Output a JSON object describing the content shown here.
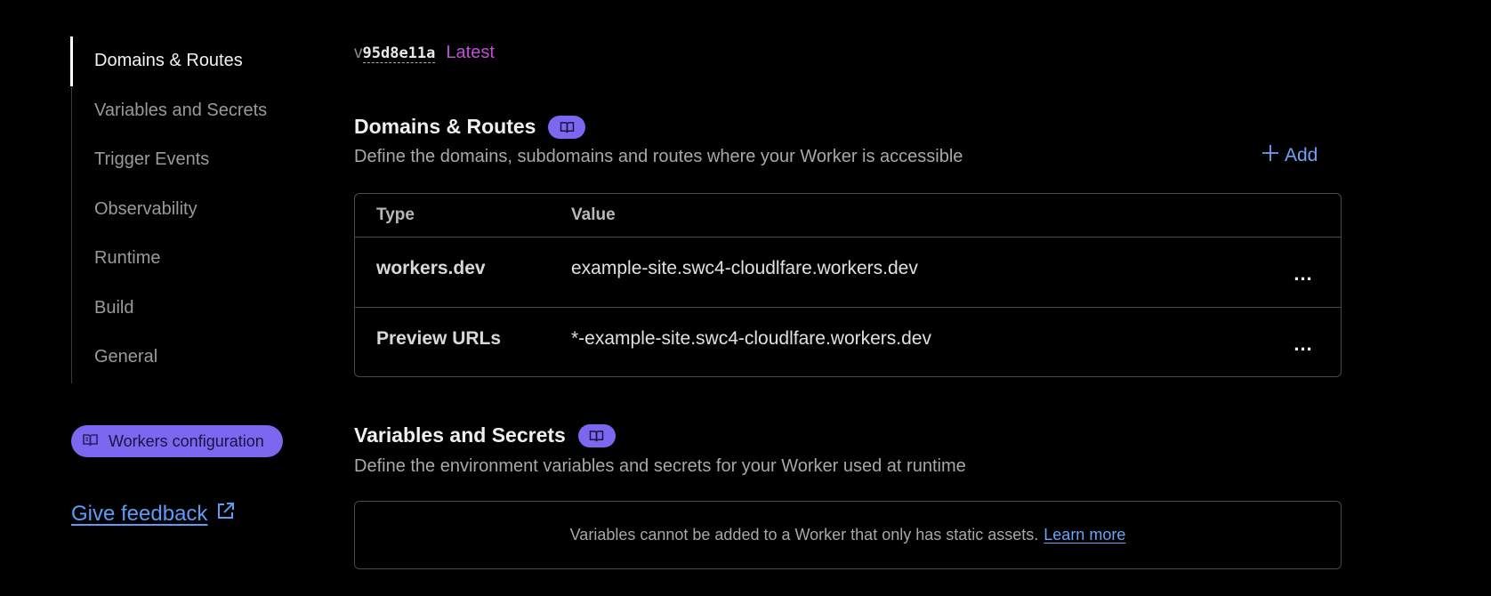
{
  "sidebar": {
    "items": [
      {
        "label": "Domains & Routes",
        "active": true
      },
      {
        "label": "Variables and Secrets"
      },
      {
        "label": "Trigger Events"
      },
      {
        "label": "Observability"
      },
      {
        "label": "Runtime"
      },
      {
        "label": "Build"
      },
      {
        "label": "General"
      }
    ],
    "config_button": {
      "label": "Workers configuration",
      "icon": "book-icon"
    },
    "feedback": {
      "label": "Give feedback",
      "icon": "external-link-icon"
    }
  },
  "version": {
    "prefix": "v",
    "hash": "95d8e11a",
    "tag": "Latest"
  },
  "domains": {
    "title": "Domains & Routes",
    "description": "Define the domains, subdomains and routes where your Worker is accessible",
    "add_label": "Add",
    "columns": [
      "Type",
      "Value"
    ],
    "rows": [
      {
        "type": "workers.dev",
        "value": "example-site.swc4-cloudlfare.workers.dev"
      },
      {
        "type": "Preview URLs",
        "value": "*-example-site.swc4-cloudlfare.workers.dev"
      }
    ],
    "row_menu": "..."
  },
  "variables": {
    "title": "Variables and Secrets",
    "description": "Define the environment variables and secrets for your Worker used at runtime",
    "notice": "Variables cannot be added to a Worker that only has static assets.",
    "learn_more": "Learn more"
  },
  "colors": {
    "background": "#000000",
    "accent_purple": "#7c68f0",
    "link_blue": "#6aa3f8",
    "latest_magenta": "#c24fd8"
  }
}
